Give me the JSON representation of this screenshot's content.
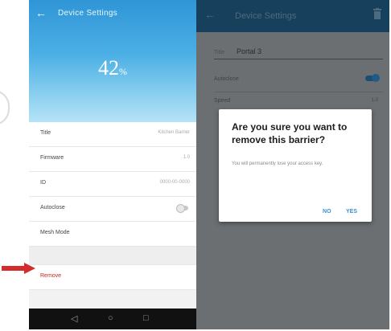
{
  "left_screen": {
    "header": {
      "title": "Device Settings"
    },
    "level": {
      "value": "42",
      "unit": "%"
    },
    "settings": [
      {
        "label": "Title",
        "value": "Kitchen Barrier"
      },
      {
        "label": "Firmware",
        "value": "1.0"
      },
      {
        "label": "ID",
        "value": "0000-00-0000"
      },
      {
        "label": "Autoclose",
        "value": ""
      },
      {
        "label": "Mesh Mode",
        "value": ""
      }
    ],
    "remove_label": "Remove"
  },
  "right_screen": {
    "header": {
      "title": "Device Settings"
    },
    "name": {
      "label": "Title",
      "value": "Portal 3"
    },
    "autoclose_label": "Autoclose",
    "speed": {
      "label": "Speed",
      "value": "1.0"
    },
    "dialog": {
      "title": "Are you sure you want to remove this barrier?",
      "body": "You will permanently lose your access key.",
      "cancel": "NO",
      "confirm": "YES"
    }
  },
  "colors": {
    "hero_top": "#2f95d6",
    "remove_red": "#c0271c",
    "dialog_action": "#3b8fd4",
    "right_header": "#16405c"
  },
  "icons": [
    "back-arrow-icon",
    "back-nav-icon",
    "home-nav-icon",
    "recents-nav-icon",
    "trash-icon",
    "red-pointer-arrow-icon"
  ]
}
